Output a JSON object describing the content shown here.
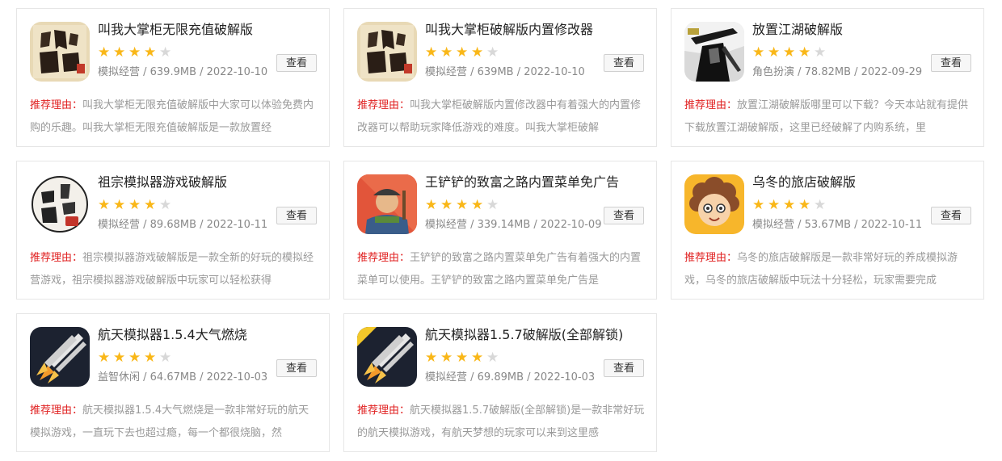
{
  "reason_label": "推荐理由：",
  "view_label": "查看",
  "colors": {
    "star_on": "#f9b718",
    "star_off": "#d8d8d8",
    "reason": "#e02020"
  },
  "apps": [
    {
      "title": "叫我大掌柜无限充值破解版",
      "rating": 4,
      "max_rating": 5,
      "meta": "模拟经营 / 639.9MB / 2022-10-10",
      "desc": "叫我大掌柜无限充值破解版中大家可以体验免费内购的乐趣。叫我大掌柜无限充值破解版是一款放置经",
      "icon": "calligraphy-logo-icon"
    },
    {
      "title": "叫我大掌柜破解版内置修改器",
      "rating": 4,
      "max_rating": 5,
      "meta": "模拟经营 / 639MB / 2022-10-10",
      "desc": "叫我大掌柜破解版内置修改器中有着强大的内置修改器可以帮助玩家降低游戏的难度。叫我大掌柜破解",
      "icon": "calligraphy-logo-icon"
    },
    {
      "title": "放置江湖破解版",
      "rating": 4,
      "max_rating": 5,
      "meta": "角色扮演 / 78.82MB / 2022-09-29",
      "desc": "放置江湖破解版哪里可以下载？今天本站就有提供下载放置江湖破解版，这里已经破解了内购系统，里",
      "icon": "swordsman-icon"
    },
    {
      "title": "祖宗模拟器游戏破解版",
      "rating": 4,
      "max_rating": 5,
      "meta": "模拟经营 / 89.68MB / 2022-10-11",
      "desc": "祖宗模拟器游戏破解版是一款全新的好玩的模拟经营游戏，祖宗模拟器游戏破解版中玩家可以轻松获得",
      "icon": "ancestor-calligraphy-icon"
    },
    {
      "title": "王铲铲的致富之路内置菜单免广告",
      "rating": 4,
      "max_rating": 5,
      "meta": "模拟经营 / 339.14MB / 2022-10-09",
      "desc": "王铲铲的致富之路内置菜单免广告有着强大的内置菜单可以使用。王铲铲的致富之路内置菜单免广告是",
      "icon": "farmer-icon"
    },
    {
      "title": "乌冬的旅店破解版",
      "rating": 4,
      "max_rating": 5,
      "meta": "模拟经营 / 53.67MB / 2022-10-11",
      "desc": "乌冬的旅店破解版是一款非常好玩的养成模拟游戏，乌冬的旅店破解版中玩法十分轻松，玩家需要完成",
      "icon": "curly-hair-girl-icon"
    },
    {
      "title": "航天模拟器1.5.4大气燃烧",
      "rating": 4,
      "max_rating": 5,
      "meta": "益智休闲 / 64.67MB / 2022-10-03",
      "desc": "航天模拟器1.5.4大气燃烧是一款非常好玩的航天模拟游戏，一直玩下去也超过瘾，每一个都很烧脑，然",
      "icon": "rocket-icon"
    },
    {
      "title": "航天模拟器1.5.7破解版(全部解锁)",
      "rating": 4,
      "max_rating": 5,
      "meta": "模拟经营 / 69.89MB / 2022-10-03",
      "desc": "航天模拟器1.5.7破解版(全部解锁)是一款非常好玩的航天模拟游戏，有航天梦想的玩家可以来到这里感",
      "icon": "rocket-icon"
    }
  ]
}
